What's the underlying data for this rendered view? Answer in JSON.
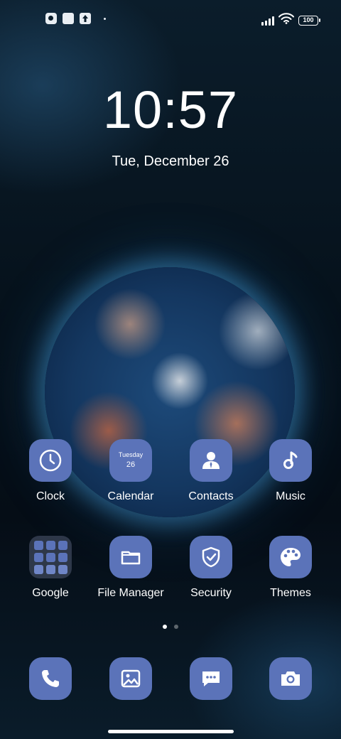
{
  "status_bar": {
    "battery": "100",
    "notification_icons": [
      "app-notification-icon",
      "square-notification-icon",
      "upload-notification-icon"
    ]
  },
  "lock": {
    "time": "10:57",
    "date": "Tue, December 26"
  },
  "apps_row1": [
    {
      "label": "Clock",
      "icon": "clock-icon"
    },
    {
      "label": "Calendar",
      "icon": "calendar-icon",
      "day": "Tuesday",
      "date_num": "26"
    },
    {
      "label": "Contacts",
      "icon": "contacts-icon"
    },
    {
      "label": "Music",
      "icon": "music-icon"
    }
  ],
  "apps_row2": [
    {
      "label": "Google",
      "icon": "google-folder-icon"
    },
    {
      "label": "File Manager",
      "icon": "folder-icon"
    },
    {
      "label": "Security",
      "icon": "shield-check-icon"
    },
    {
      "label": "Themes",
      "icon": "palette-icon"
    }
  ],
  "page_indicator": {
    "pages": 2,
    "active": 1
  },
  "dock": [
    {
      "icon": "phone-icon"
    },
    {
      "icon": "gallery-icon"
    },
    {
      "icon": "messages-icon"
    },
    {
      "icon": "camera-icon"
    }
  ],
  "colors": {
    "icon_background": "#5b73b9",
    "text": "#ffffff"
  }
}
